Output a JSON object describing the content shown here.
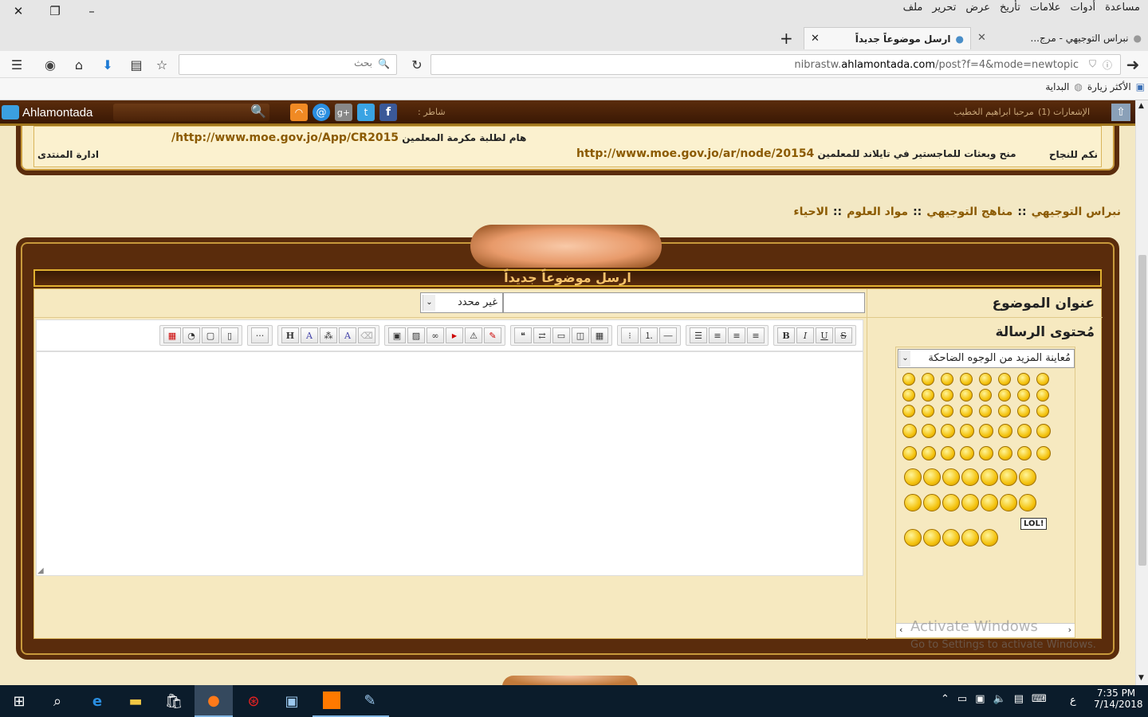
{
  "window": {
    "close": "✕",
    "restore": "❐",
    "minimize": "–"
  },
  "menu": [
    "ملف",
    "تحرير",
    "عرض",
    "تأريخ",
    "علامات",
    "أدوات",
    "مساعدة"
  ],
  "tabs": [
    {
      "label": "نبراس التوجيهي - مرج..."
    },
    {
      "label": "ارسل موضوعاً جديداً",
      "active": true
    }
  ],
  "new_tab": "+",
  "url": {
    "prefix": "nibrastw.",
    "host": "ahlamontada.com",
    "path": "/post?f=4&mode=newtopic"
  },
  "search": {
    "placeholder": "بحث"
  },
  "bookmarks": {
    "most_visited": "الأكثر زيارة",
    "start": "البداية"
  },
  "forumbar": {
    "brand": "Ahlamontada",
    "notifications": "الإشعارات (1)",
    "welcome": "مرحبا ابراهيم الخطيب",
    "follow": "شاطر :"
  },
  "notices": {
    "row1_right": "نكم للنجاح",
    "row1_mid_text": "منح وبعثات للماجستير في تايلاند للمعلمين",
    "row1_mid_link": "http://www.moe.gov.jo/ar/node/20154",
    "row2_text": "هام لطلبة مكرمة المعلمين",
    "row2_link": "http://www.moe.gov.jo/App/CR2015/",
    "admin": "ادارة المنتدى"
  },
  "breadcrumb": {
    "home": "نبراس التوجيهي",
    "sep": "::",
    "l1": "مناهج التوجيهي",
    "l2": "مواد العلوم",
    "l3": "الاحياء"
  },
  "post": {
    "heading": "ارسل موضوعاً جديداً",
    "subject_label": "عنوان الموضوع",
    "prefix_value": "غير محدد",
    "message_label": "مُحتوى الرسالة",
    "subject_value": ""
  },
  "smilies": {
    "select": "مُعاينة المزيد من الوجوه الضاحكة",
    "lol_text": "LOL!"
  },
  "watermark": {
    "line1": "Activate Windows",
    "line2": "Go to Settings to activate Windows."
  },
  "taskbar": {
    "time": "7:35 PM",
    "date": "7/14/2018",
    "lang": "ع"
  },
  "colors": {
    "accent": "#5a2c0c",
    "link": "#8b5a00",
    "heading": "#f6c36b"
  }
}
